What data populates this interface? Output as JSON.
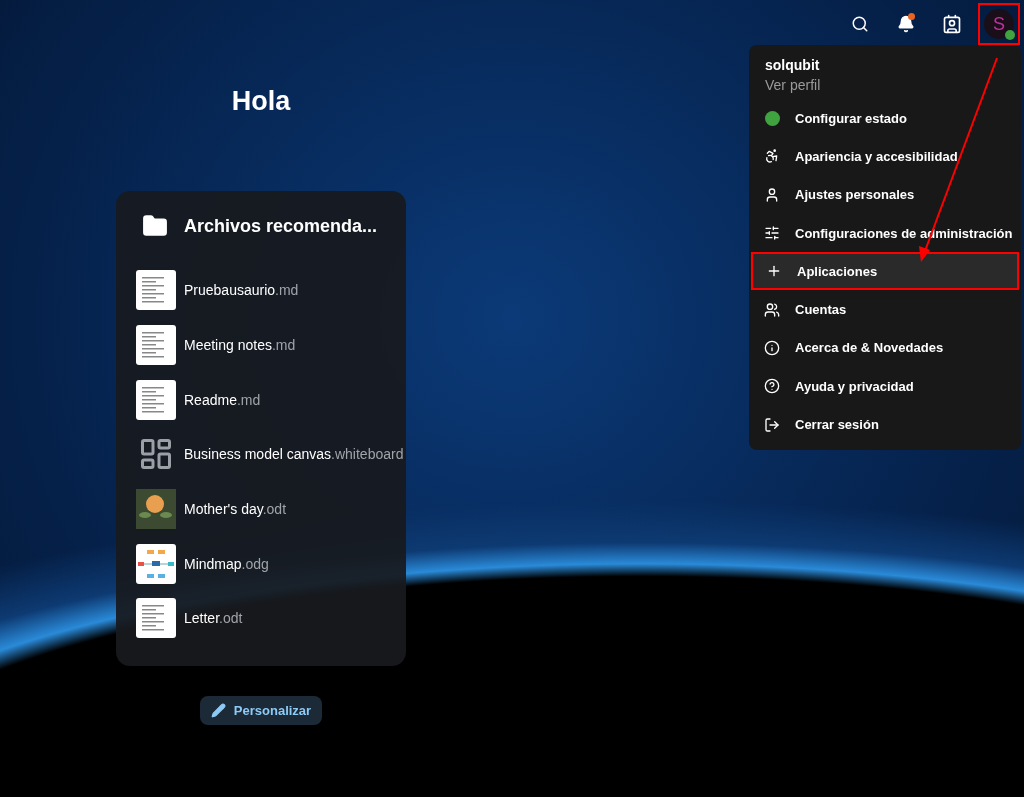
{
  "header": {
    "notifications": {
      "unread": true
    },
    "avatar": {
      "letter": "S",
      "color": "#3fa33f",
      "annotated": true
    }
  },
  "greeting": "Hola",
  "widget": {
    "title": "Archivos recomenda...",
    "files": [
      {
        "name": "Pruebausaurio",
        "ext": ".md",
        "kind": "document"
      },
      {
        "name": "Meeting notes",
        "ext": ".md",
        "kind": "document"
      },
      {
        "name": "Readme",
        "ext": ".md",
        "kind": "document"
      },
      {
        "name": "Business model canvas",
        "ext": ".whiteboard",
        "kind": "whiteboard"
      },
      {
        "name": "Mother's day",
        "ext": ".odt",
        "kind": "photo"
      },
      {
        "name": "Mindmap",
        "ext": ".odg",
        "kind": "mindmap"
      },
      {
        "name": "Letter",
        "ext": ".odt",
        "kind": "document"
      }
    ]
  },
  "customize_button": "Personalizar",
  "user_menu": {
    "username": "solqubit",
    "profile_link": "Ver perfil",
    "items": [
      {
        "label": "Configurar estado",
        "kind": "status",
        "color": "#3fa33f",
        "selected": false,
        "annotated": false
      },
      {
        "label": "Apariencia y accesibilidad",
        "kind": "appearance",
        "selected": false,
        "annotated": false
      },
      {
        "label": "Ajustes personales",
        "kind": "person",
        "selected": false,
        "annotated": false
      },
      {
        "label": "Configuraciones de administración",
        "kind": "admin",
        "selected": false,
        "annotated": false
      },
      {
        "label": "Aplicaciones",
        "kind": "apps",
        "selected": true,
        "annotated": true
      },
      {
        "label": "Cuentas",
        "kind": "accounts",
        "selected": false,
        "annotated": false
      },
      {
        "label": "Acerca de & Novedades",
        "kind": "info",
        "selected": false,
        "annotated": false
      },
      {
        "label": "Ayuda y privacidad",
        "kind": "help",
        "selected": false,
        "annotated": false
      },
      {
        "label": "Cerrar sesión",
        "kind": "logout",
        "selected": false,
        "annotated": false
      }
    ]
  }
}
